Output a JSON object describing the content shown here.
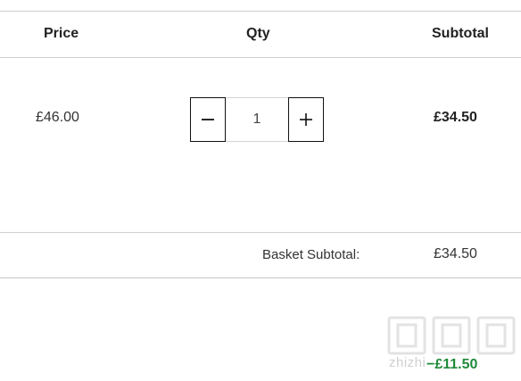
{
  "table_header": {
    "price": "Price",
    "qty": "Qty",
    "subtotal": "Subtotal"
  },
  "line_item": {
    "price": "£46.00",
    "quantity": "1",
    "subtotal": "£34.50",
    "decrease_icon": "minus-icon",
    "increase_icon": "plus-icon"
  },
  "basket": {
    "subtotal_label": "Basket Subtotal:",
    "subtotal_value": "£34.50",
    "discount_value": "−£11.50"
  },
  "watermark": {
    "text": "zhizhi",
    "logo": "值值值"
  },
  "colors": {
    "discount": "#1f8a3a",
    "rule": "#cfcfcf",
    "border": "#111111"
  }
}
